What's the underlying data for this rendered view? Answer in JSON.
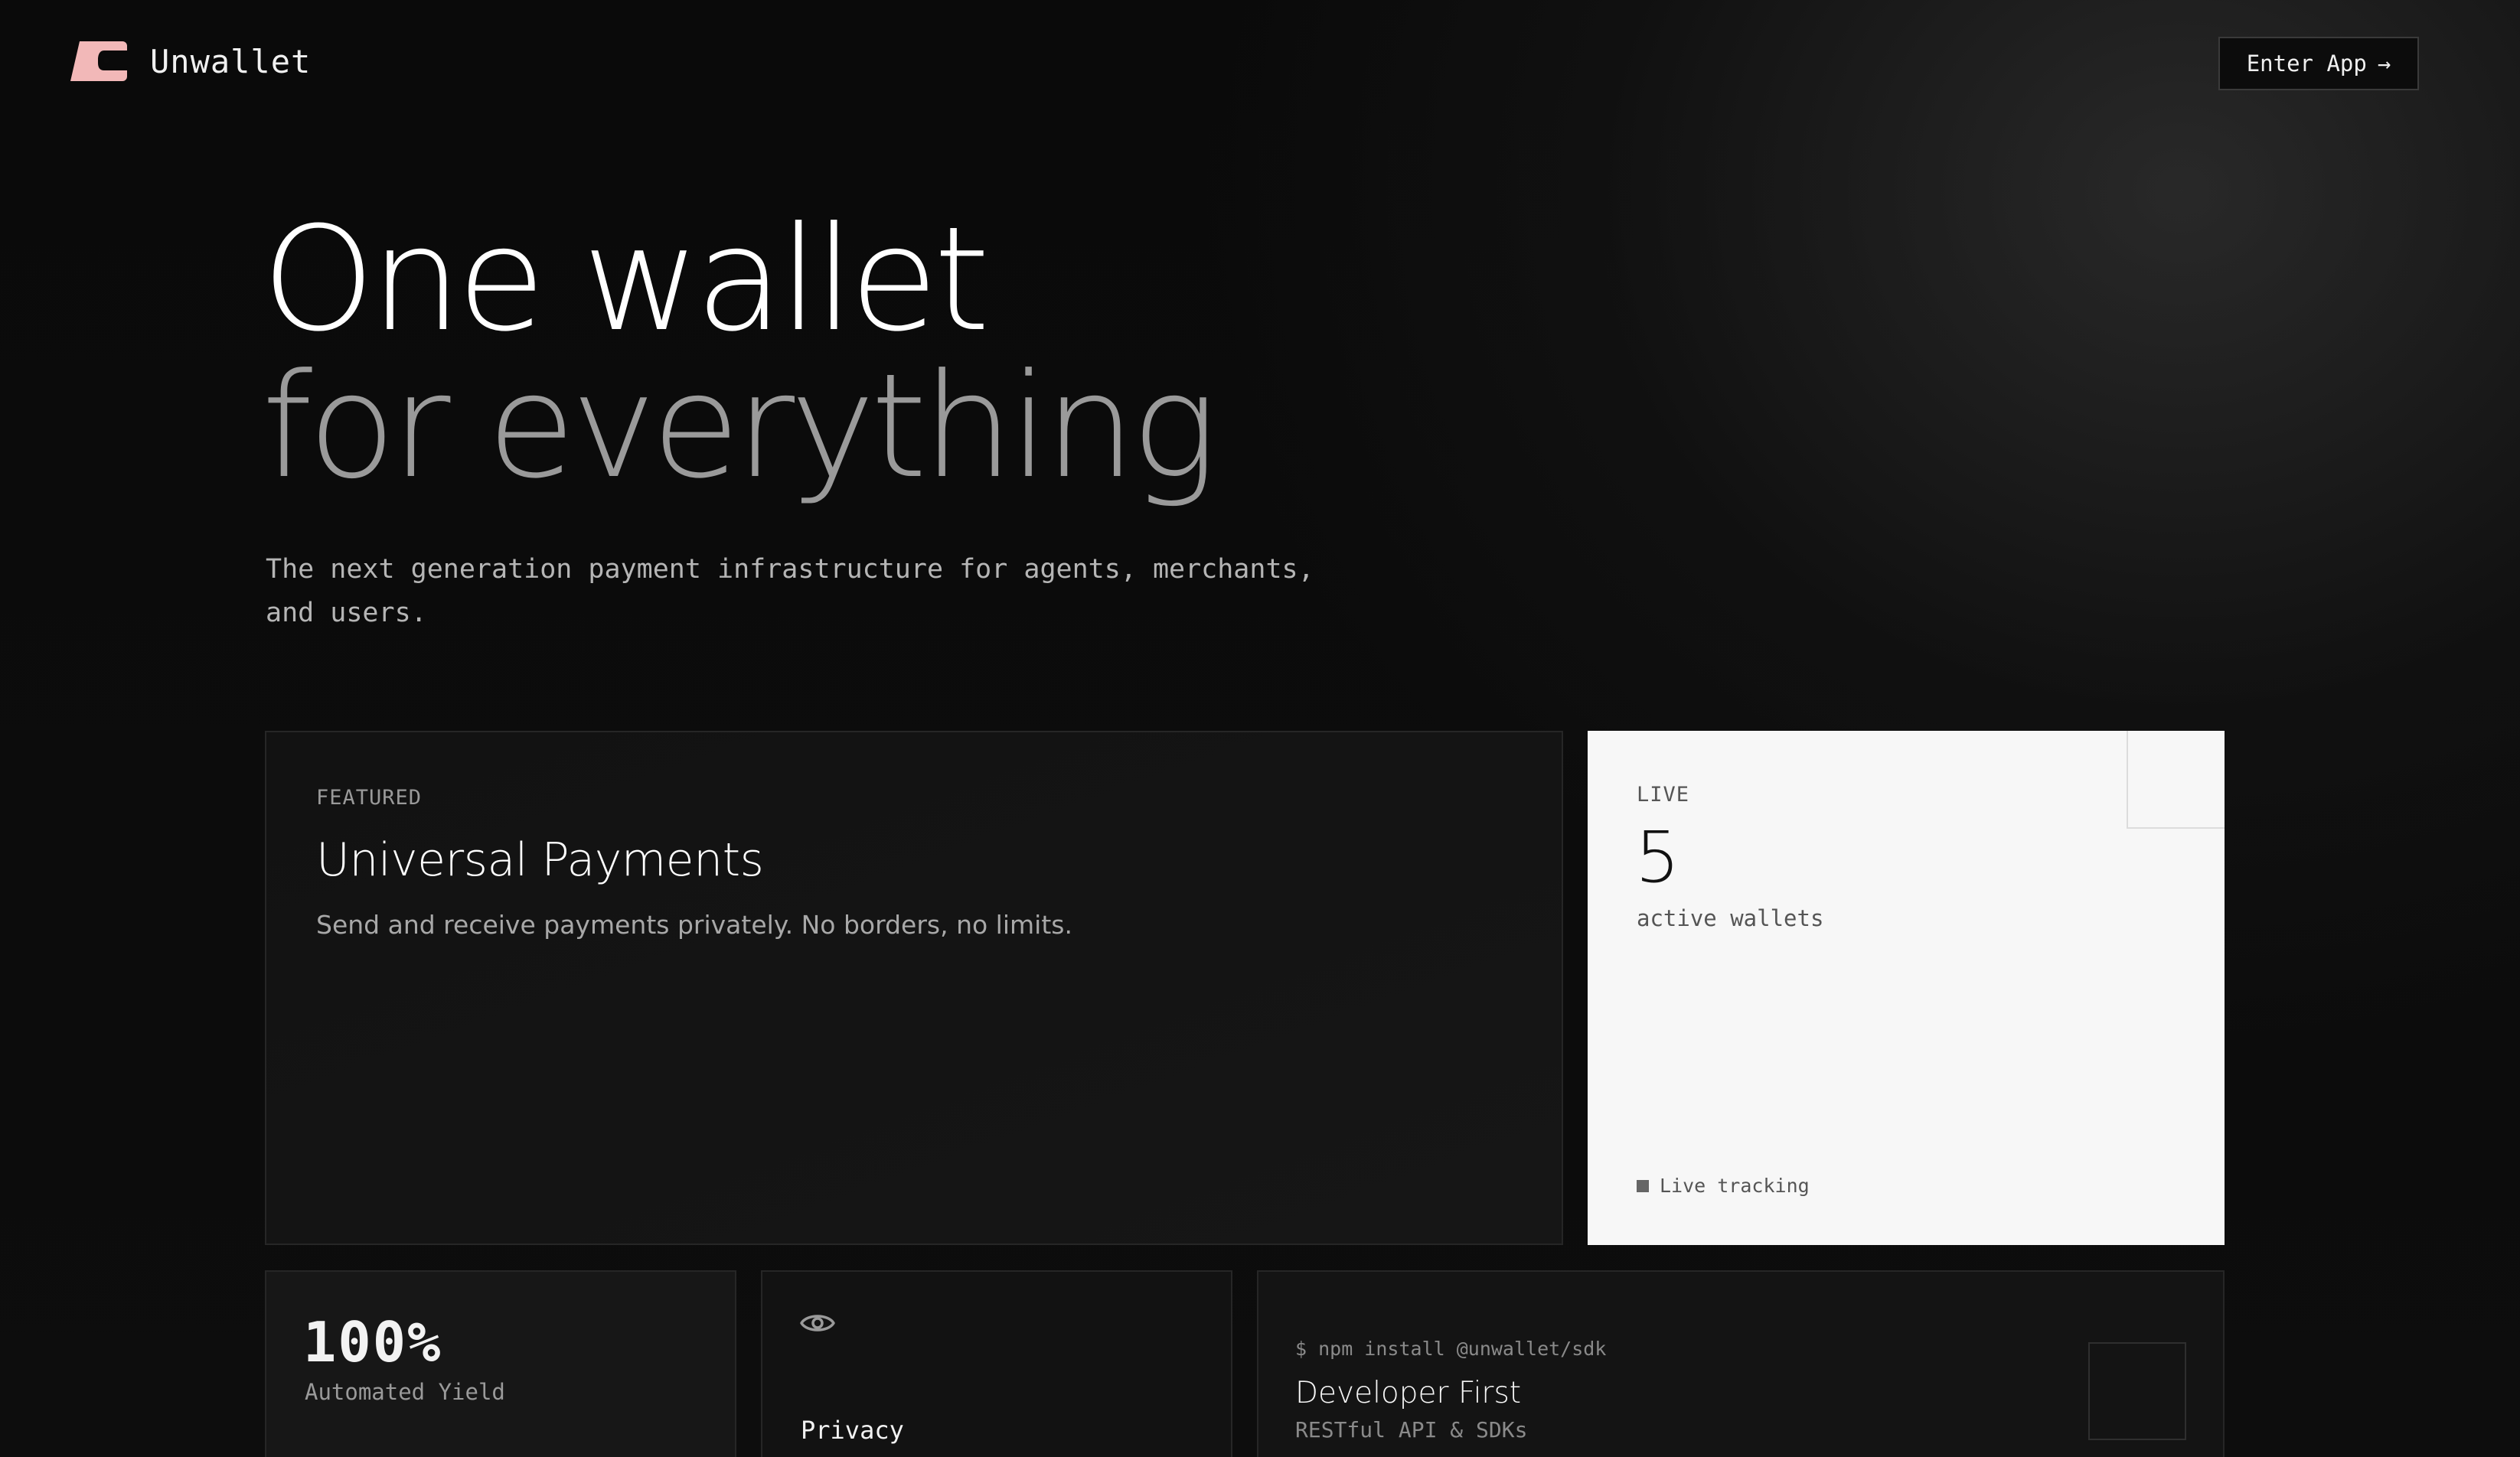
{
  "header": {
    "brand": "Unwallet",
    "logo_icon": "unwallet-logo-icon",
    "logo_color": "#f2b8b8",
    "cta_label": "Enter App",
    "cta_arrow": "→"
  },
  "hero": {
    "title_line1": "One wallet",
    "title_line2": "for everything",
    "subtitle": "The next generation payment infrastructure for agents, merchants, and users."
  },
  "featured_card": {
    "label": "FEATURED",
    "title": "Universal Payments",
    "description": "Send and receive payments privately. No borders, no limits."
  },
  "live_card": {
    "label": "LIVE",
    "count": "5",
    "count_label": "active wallets",
    "tracking_label": "Live tracking"
  },
  "yield_card": {
    "value": "100%",
    "label": "Automated Yield"
  },
  "privacy_card": {
    "icon": "eye-icon",
    "title": "Privacy"
  },
  "dev_card": {
    "command": "$ npm install @unwallet/sdk",
    "title": "Developer First",
    "subtitle": "RESTful API & SDKs"
  }
}
